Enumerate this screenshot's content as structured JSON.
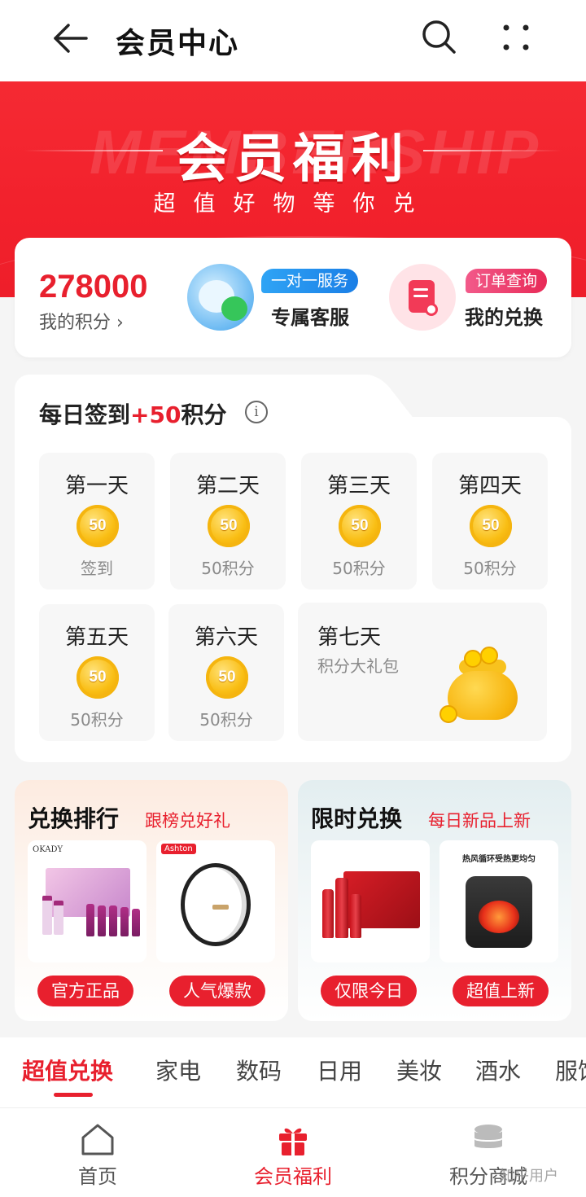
{
  "header": {
    "title": "会员中心",
    "back_icon": "arrow-left-icon",
    "search_icon": "search-icon",
    "more_icon": "more-dots-icon"
  },
  "banner": {
    "title": "会员福利",
    "subtitle": "超值好物等你兑",
    "watermark": "MEMBERSHIP"
  },
  "points": {
    "value": "278000",
    "label": "我的积分 ›",
    "service": {
      "tag": "一对一服务",
      "label": "专属客服"
    },
    "exchange": {
      "tag": "订单查询",
      "label": "我的兑换"
    }
  },
  "checkin": {
    "title_prefix": "每日签到",
    "title_bonus": "+50",
    "title_suffix": "积分",
    "days": [
      {
        "name": "第一天",
        "coin": "50",
        "value": "签到"
      },
      {
        "name": "第二天",
        "coin": "50",
        "value": "50积分"
      },
      {
        "name": "第三天",
        "coin": "50",
        "value": "50积分"
      },
      {
        "name": "第四天",
        "coin": "50",
        "value": "50积分"
      },
      {
        "name": "第五天",
        "coin": "50",
        "value": "50积分"
      },
      {
        "name": "第六天",
        "coin": "50",
        "value": "50积分"
      }
    ],
    "day7": {
      "name": "第七天",
      "sub": "积分大礼包"
    }
  },
  "promos": {
    "ranking": {
      "title": "兑换排行",
      "subtitle": "跟榜兑好礼",
      "products": [
        {
          "brand": "OKADY",
          "pill": "官方正品"
        },
        {
          "brand": "Ashton",
          "pill": "人气爆款"
        }
      ]
    },
    "limited": {
      "title": "限时兑换",
      "subtitle": "每日新品上新",
      "products": [
        {
          "brand": "",
          "pill": "仅限今日"
        },
        {
          "caption": "热风循环受热更均匀",
          "pill": "超值上新"
        }
      ]
    }
  },
  "categories": [
    "超值兑换",
    "家电",
    "数码",
    "日用",
    "美妆",
    "酒水",
    "服饰"
  ],
  "bottom_nav": [
    {
      "label": "首页",
      "icon": "home-icon"
    },
    {
      "label": "会员福利",
      "icon": "gift-icon",
      "active": true
    },
    {
      "label": "积分商城",
      "icon": "coins-stack-icon"
    }
  ],
  "watermark": "知乎用户",
  "colors": {
    "accent": "#e8202e",
    "banner": "#f2212c",
    "coin": "#f9be14"
  }
}
